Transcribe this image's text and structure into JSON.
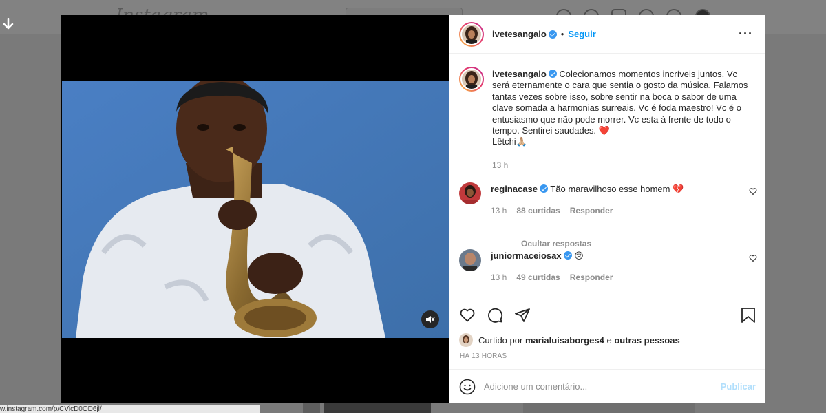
{
  "background": {
    "logo": "Instagram"
  },
  "post": {
    "author": "ivetesangalo",
    "follow_label": "Seguir",
    "caption": "Colecionamos momentos incríveis juntos. Vc será eternamente o cara que sentia o gosto da música. Falamos tantas vezes sobre isso, sobre sentir na boca o sabor de uma clave somada a harmonias surreais. Vc é foda maestro! Vc é o entusiasmo que não pode morrer. Vc esta à frente de todo o tempo. Sentirei saudades. ❤️",
    "signature": "Lêtchi🙏🏼",
    "caption_time": "13 h",
    "comments": [
      {
        "user": "reginacase",
        "text": "Tão maravilhoso esse homem 💔",
        "time": "13 h",
        "likes": "88 curtidas",
        "reply": "Responder",
        "avatar_color": "#c0393b"
      },
      {
        "user": "juniormaceiosax",
        "text": "😢",
        "time": "13 h",
        "likes": "49 curtidas",
        "reply": "Responder",
        "avatar_color": "#6b7a8c"
      }
    ],
    "hide_replies": "Ocultar respostas",
    "liked_by_prefix": "Curtido por",
    "liked_by_user": "marialuisaborges4",
    "liked_by_and": "e",
    "liked_by_others": "outras pessoas",
    "posted_ago": "HÁ 13 HORAS",
    "comment_placeholder": "Adicione um comentário...",
    "publish_label": "Publicar"
  },
  "status_bar": {
    "url": "w.instagram.com/p/CVicD0OD6jl/"
  },
  "colors": {
    "accent": "#0095f6",
    "verified": "#3897f0",
    "video_bg": "#4f7fbd"
  }
}
